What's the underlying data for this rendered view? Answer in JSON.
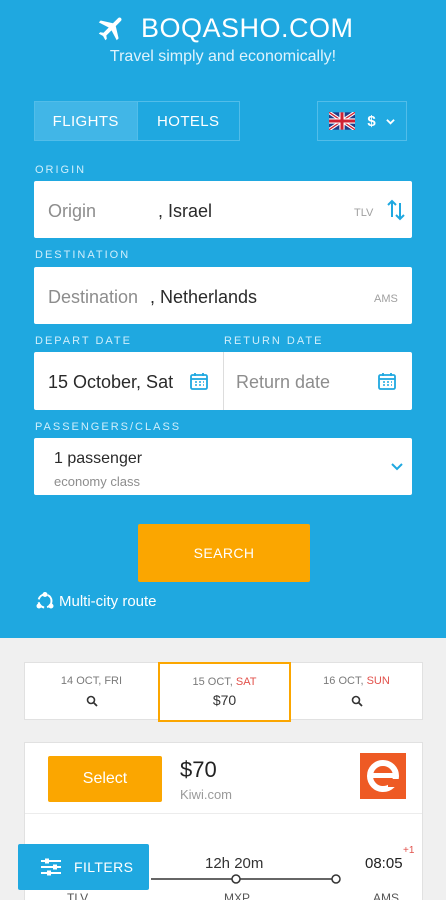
{
  "brand": {
    "name": "BOQASHO.COM",
    "tagline": "Travel simply and economically!"
  },
  "tabs": [
    {
      "label": "FLIGHTS",
      "active": true
    },
    {
      "label": "HOTELS",
      "active": false
    }
  ],
  "currency": {
    "symbol": "$",
    "flag_icon": "uk-flag-icon"
  },
  "form": {
    "origin": {
      "label": "ORIGIN",
      "placeholder": "Origin",
      "country": ", Israel",
      "code": "TLV"
    },
    "destination": {
      "label": "DESTINATION",
      "placeholder": "Destination",
      "country": ", Netherlands",
      "code": "AMS"
    },
    "depart": {
      "label": "DEPART DATE",
      "value": "15 October, Sat"
    },
    "return": {
      "label": "RETURN DATE",
      "placeholder": "Return date"
    },
    "passengers": {
      "label": "PASSENGERS/CLASS",
      "count": "1 passenger",
      "class": "economy class"
    },
    "search_label": "SEARCH",
    "multicity_label": "Multi-city route"
  },
  "date_options": [
    {
      "date": "14 OCT, ",
      "weekday": "FRI",
      "weekend": false,
      "price": null,
      "selected": false
    },
    {
      "date": "15 OCT, ",
      "weekday": "SAT",
      "weekend": true,
      "price": "$70",
      "selected": true
    },
    {
      "date": "16 OCT, ",
      "weekday": "SUN",
      "weekend": true,
      "price": null,
      "selected": false
    }
  ],
  "result": {
    "select_label": "Select",
    "price": "$70",
    "provider": "Kiwi.com",
    "duration": "12h 20m",
    "arrival_time": "08:05",
    "day_offset": "+1",
    "airports": [
      "TLV",
      "MXP",
      "AMS"
    ]
  },
  "filters_label": "FILTERS",
  "colors": {
    "primary": "#1fa8e0",
    "accent": "#fba600",
    "weekend": "#e2514b",
    "carrier": "#ee5a24"
  }
}
